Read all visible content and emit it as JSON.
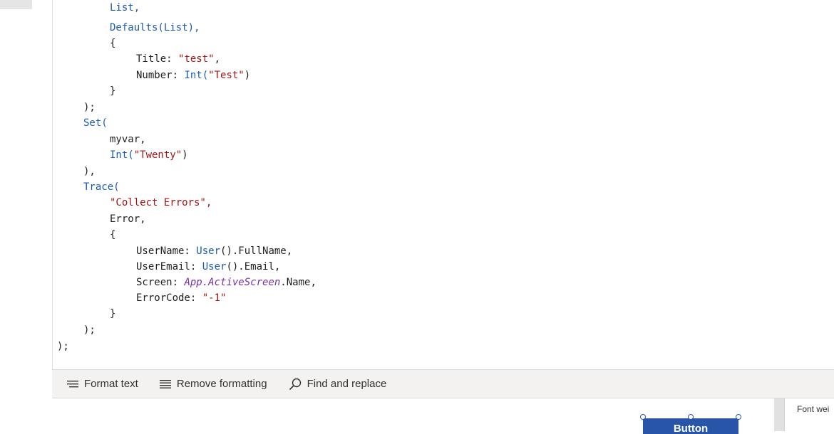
{
  "code": {
    "l1": "List,",
    "l2": "Defaults(List),",
    "l3": "{",
    "l4_key": "Title: ",
    "l4_val": "\"test\"",
    "l5_key": "Number: ",
    "l5_fn": "Int(",
    "l5_val": "\"Test\"",
    "l5_end": ")",
    "l6": "}",
    "l7": ");",
    "l8_fn": "Set(",
    "l9": "myvar,",
    "l10_fn": "Int(",
    "l10_val": "\"Twenty\"",
    "l10_end": ")",
    "l11": "),",
    "l12_fn": "Trace(",
    "l13_val": "\"Collect Errors\",",
    "l14": "Error,",
    "l15": "{",
    "l16_key": "UserName: ",
    "l16_fn": "User",
    "l16_rest": "().FullName,",
    "l17_key": "UserEmail: ",
    "l17_fn": "User",
    "l17_rest": "().Email,",
    "l18_key": "Screen: ",
    "l18_app": "App.ActiveScreen",
    "l18_rest": ".Name,",
    "l19_key": "ErrorCode: ",
    "l19_val": "\"-1\"",
    "l20": "}",
    "l21": ");",
    "l22": ");"
  },
  "toolbar": {
    "format_text": "Format text",
    "remove_formatting": "Remove formatting",
    "find_replace": "Find and replace"
  },
  "canvas": {
    "button_label": "Button"
  },
  "properties": {
    "font_weight_label": "Font wei"
  },
  "icons": {
    "format": "format-text-icon",
    "remove": "remove-formatting-icon",
    "find": "search-icon"
  }
}
